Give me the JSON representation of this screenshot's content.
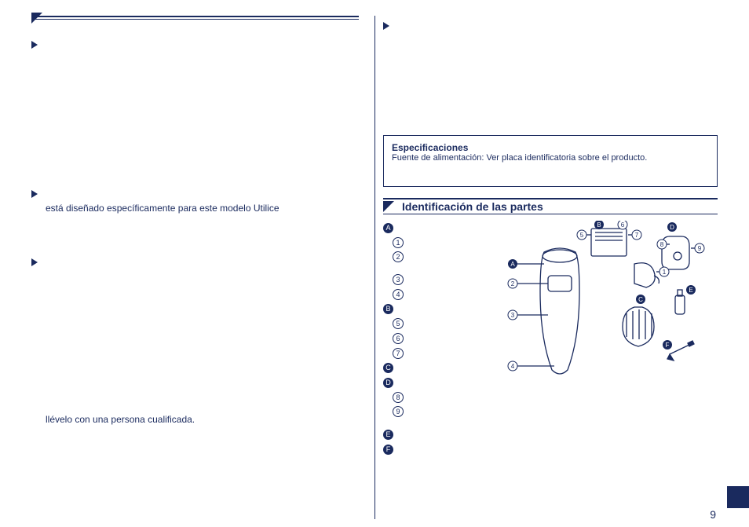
{
  "left": {
    "body1": "está diseñado específicamente para este modelo Utilice",
    "body2": "llévelo con una persona cualificada."
  },
  "right": {
    "spec_title": "Especificaciones",
    "spec_text": "Fuente de alimentación: Ver placa identificatoria sobre el producto.",
    "section_title": "Identificación de las partes",
    "list": {
      "A": [
        "1",
        "2",
        "3",
        "4"
      ],
      "B": [
        "5",
        "6",
        "7"
      ],
      "C": [],
      "D": [
        "8",
        "9"
      ],
      "E": [],
      "F": []
    }
  },
  "page_number": "9"
}
